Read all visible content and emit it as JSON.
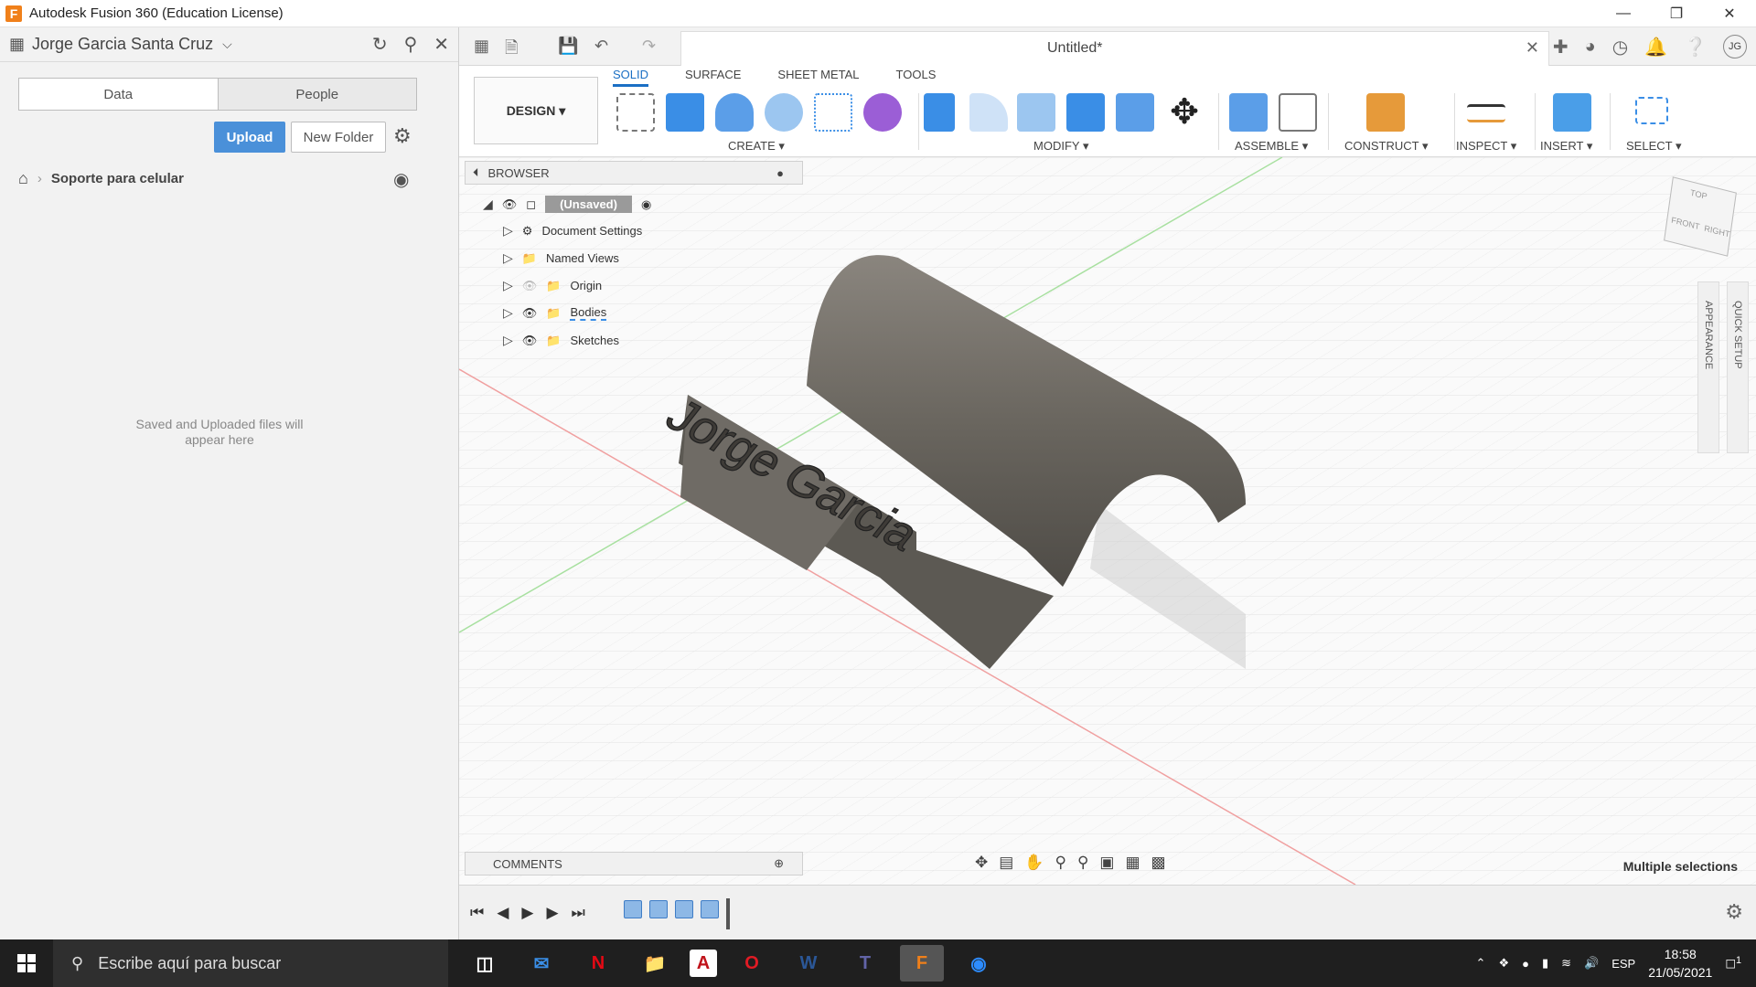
{
  "window": {
    "title": "Autodesk Fusion 360 (Education License)"
  },
  "data_panel": {
    "user": "Jorge Garcia Santa Cruz",
    "tabs": [
      "Data",
      "People"
    ],
    "upload_label": "Upload",
    "new_folder_label": "New Folder",
    "project": "Soporte para celular",
    "empty_message": "Saved and Uploaded files will appear here"
  },
  "document": {
    "tab_name": "Untitled*",
    "avatar": "JG"
  },
  "ribbon": {
    "workspace": "DESIGN",
    "tabs": [
      "SOLID",
      "SURFACE",
      "SHEET METAL",
      "TOOLS"
    ],
    "groups": [
      "CREATE",
      "MODIFY",
      "ASSEMBLE",
      "CONSTRUCT",
      "INSPECT",
      "INSERT",
      "SELECT"
    ]
  },
  "browser": {
    "title": "BROWSER",
    "root": "(Unsaved)",
    "items": [
      "Document Settings",
      "Named Views",
      "Origin",
      "Bodies",
      "Sketches"
    ]
  },
  "model": {
    "engraving": "Jorge Garcia"
  },
  "side_panels": [
    "APPEARANCE",
    "QUICK SETUP"
  ],
  "viewcube": {
    "top": "TOP",
    "front": "FRONT",
    "right": "RIGHT"
  },
  "comments": {
    "label": "COMMENTS"
  },
  "status": {
    "selection": "Multiple selections"
  },
  "taskbar": {
    "search_placeholder": "Escribe aquí para buscar",
    "lang": "ESP",
    "time": "18:58",
    "date": "21/05/2021",
    "notif": "1"
  },
  "colors": {
    "accent": "#1a6fc4",
    "upload": "#4a90d9",
    "model": "#6e6a64"
  }
}
